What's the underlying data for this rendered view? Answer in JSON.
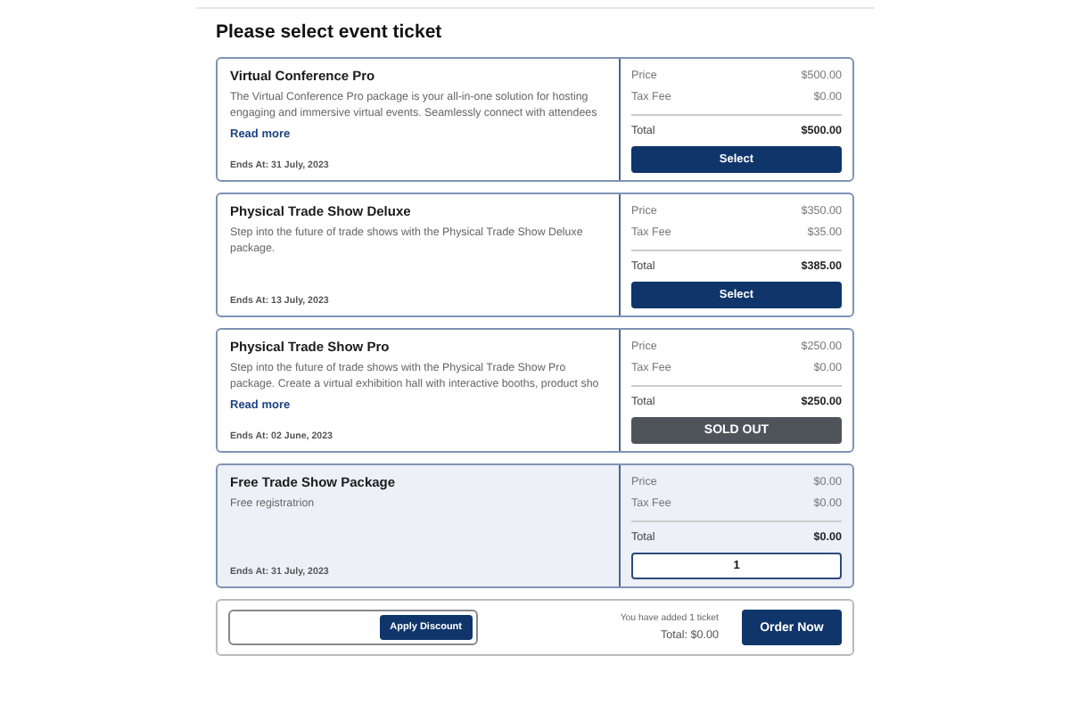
{
  "heading": "Please select event ticket",
  "tickets": [
    {
      "name": "Virtual Conference Pro",
      "description": "The Virtual Conference Pro package is your all-in-one solution for hosting engaging and immersive virtual events. Seamlessly connect with attendees",
      "read_more": "Read more",
      "ends": "Ends At: 31 July, 2023",
      "price_label": "Price",
      "price": "$500.00",
      "tax_label": "Tax Fee",
      "tax": "$0.00",
      "total_label": "Total",
      "total": "$500.00",
      "kind": "select",
      "action": "Select",
      "selected": false
    },
    {
      "name": "Physical Trade Show Deluxe",
      "description": "Step into the future of trade shows with the Physical Trade Show Deluxe package.",
      "ends": "Ends At: 13 July, 2023",
      "price_label": "Price",
      "price": "$350.00",
      "tax_label": "Tax Fee",
      "tax": "$35.00",
      "total_label": "Total",
      "total": "$385.00",
      "kind": "select",
      "action": "Select",
      "selected": false
    },
    {
      "name": "Physical Trade Show Pro",
      "description": "Step into the future of trade shows with the Physical Trade Show Pro package. Create a virtual exhibition hall with interactive booths, product sho",
      "read_more": "Read more",
      "ends": "Ends At: 02 June, 2023",
      "price_label": "Price",
      "price": "$250.00",
      "tax_label": "Tax Fee",
      "tax": "$0.00",
      "total_label": "Total",
      "total": "$250.00",
      "kind": "sold_out",
      "action": "SOLD OUT",
      "selected": false
    },
    {
      "name": "Free Trade Show Package",
      "description": "Free registratrion",
      "ends": "Ends At: 31 July, 2023",
      "price_label": "Price",
      "price": "$0.00",
      "tax_label": "Tax Fee",
      "tax": "$0.00",
      "total_label": "Total",
      "total": "$0.00",
      "kind": "quantity",
      "action": "1",
      "selected": true
    }
  ],
  "footer": {
    "discount_button": "Apply Discount",
    "summary": "You have added 1 ticket",
    "total": "Total: $0.00",
    "order_button": "Order Now"
  }
}
